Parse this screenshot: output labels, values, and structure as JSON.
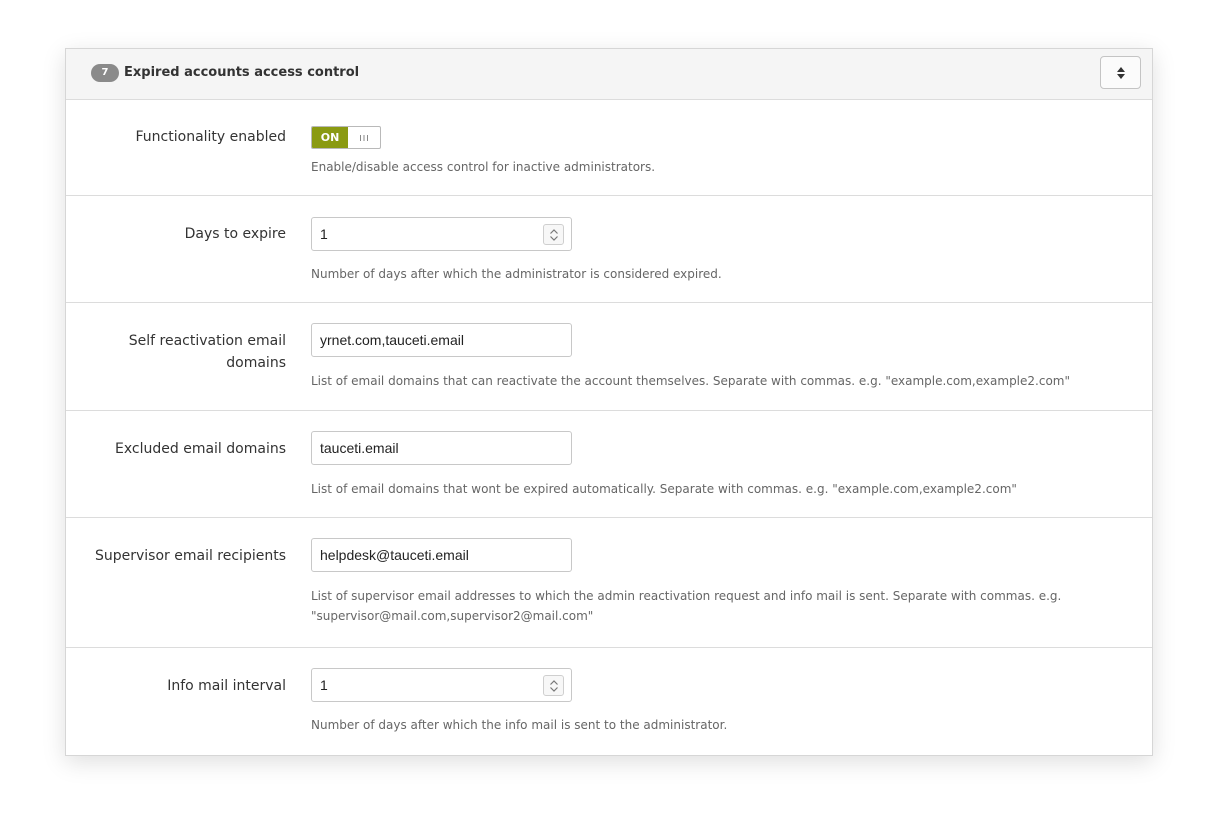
{
  "panel": {
    "step_number": "7",
    "title": "Expired accounts access control",
    "collapse_icon": "sort-arrows-icon"
  },
  "fields": {
    "functionality": {
      "label": "Functionality enabled",
      "state": "ON",
      "help": "Enable/disable access control for inactive administrators."
    },
    "days_to_expire": {
      "label": "Days to expire",
      "value": "1",
      "help": "Number of days after which the administrator is considered expired."
    },
    "self_reactivation": {
      "label_line1": "Self reactivation email",
      "label_line2": "domains",
      "value": "yrnet.com,tauceti.email",
      "help": "List of email domains that can reactivate the account themselves. Separate with commas. e.g. \"example.com,example2.com\""
    },
    "excluded_domains": {
      "label": "Excluded email domains",
      "value": "tauceti.email",
      "help": "List of email domains that wont be expired automatically. Separate with commas. e.g. \"example.com,example2.com\""
    },
    "supervisor_recipients": {
      "label": "Supervisor email recipients",
      "value": "helpdesk@tauceti.email",
      "help_line1": "List of supervisor email addresses to which the admin reactivation request and info mail is sent. Separate with commas. e.g.",
      "help_line2": "\"supervisor@mail.com,supervisor2@mail.com\""
    },
    "info_mail_interval": {
      "label": "Info mail interval",
      "value": "1",
      "help": "Number of days after which the info mail is sent to the administrator."
    }
  }
}
